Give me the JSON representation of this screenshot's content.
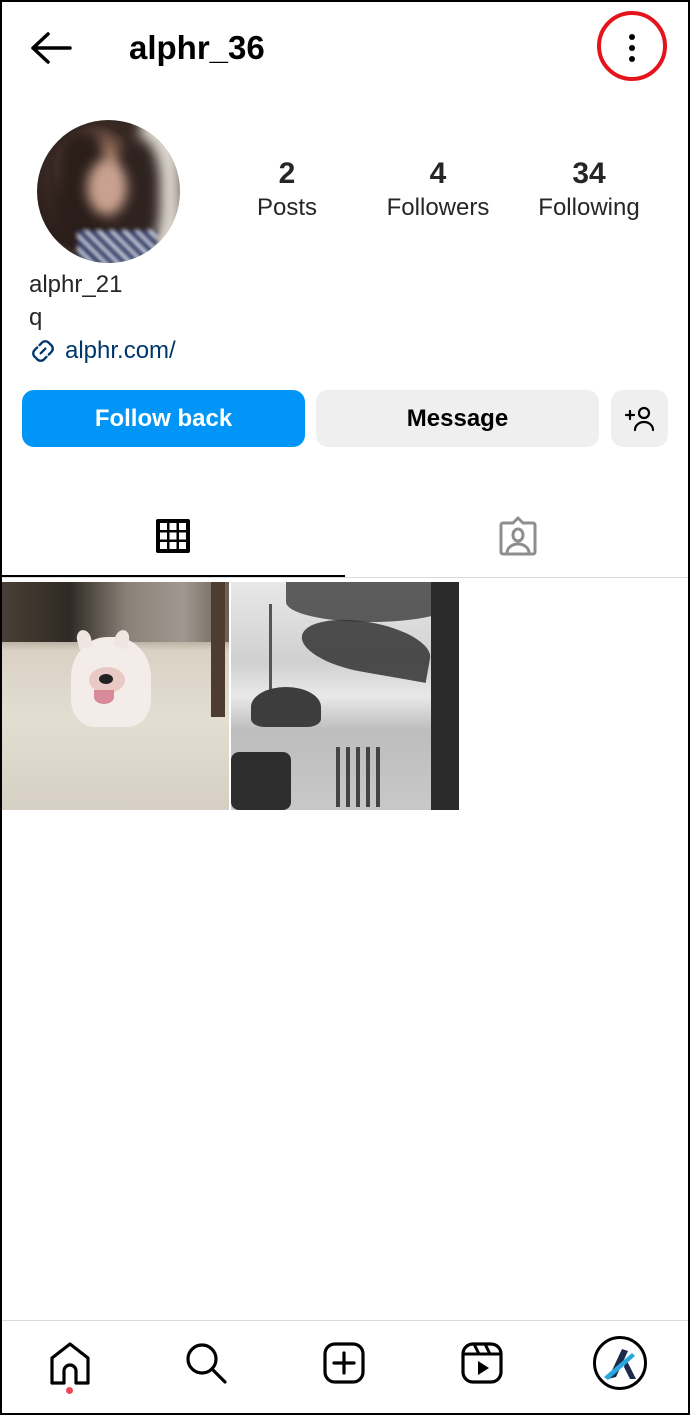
{
  "header": {
    "username": "alphr_36",
    "back_icon": "arrow-left-icon",
    "more_icon": "more-vertical-icon"
  },
  "profile": {
    "display_name": "alphr_21",
    "bio": "q",
    "link": "alphr.com/",
    "stats": [
      {
        "value": "2",
        "label": "Posts"
      },
      {
        "value": "4",
        "label": "Followers"
      },
      {
        "value": "34",
        "label": "Following"
      }
    ]
  },
  "actions": {
    "follow_back": "Follow back",
    "message": "Message",
    "suggest_icon": "add-person-icon"
  },
  "tabs": [
    {
      "name": "posts-grid",
      "icon": "grid-icon",
      "active": true
    },
    {
      "name": "tagged",
      "icon": "tagged-person-icon",
      "active": false
    }
  ],
  "posts": [
    {
      "description": "White bulldog on sand"
    },
    {
      "description": "Black and white beach with palm tree"
    }
  ],
  "bottom_nav": [
    {
      "name": "home",
      "icon": "home-icon",
      "notification": true
    },
    {
      "name": "search",
      "icon": "search-icon"
    },
    {
      "name": "create",
      "icon": "plus-square-icon"
    },
    {
      "name": "reels",
      "icon": "reels-icon"
    },
    {
      "name": "profile",
      "icon": "avatar-icon"
    }
  ],
  "colors": {
    "primary_button": "#0095f6",
    "secondary_button": "#efefef",
    "link": "#00376b",
    "notification_dot": "#ed4956",
    "annotation_ring": "#e3141b"
  }
}
